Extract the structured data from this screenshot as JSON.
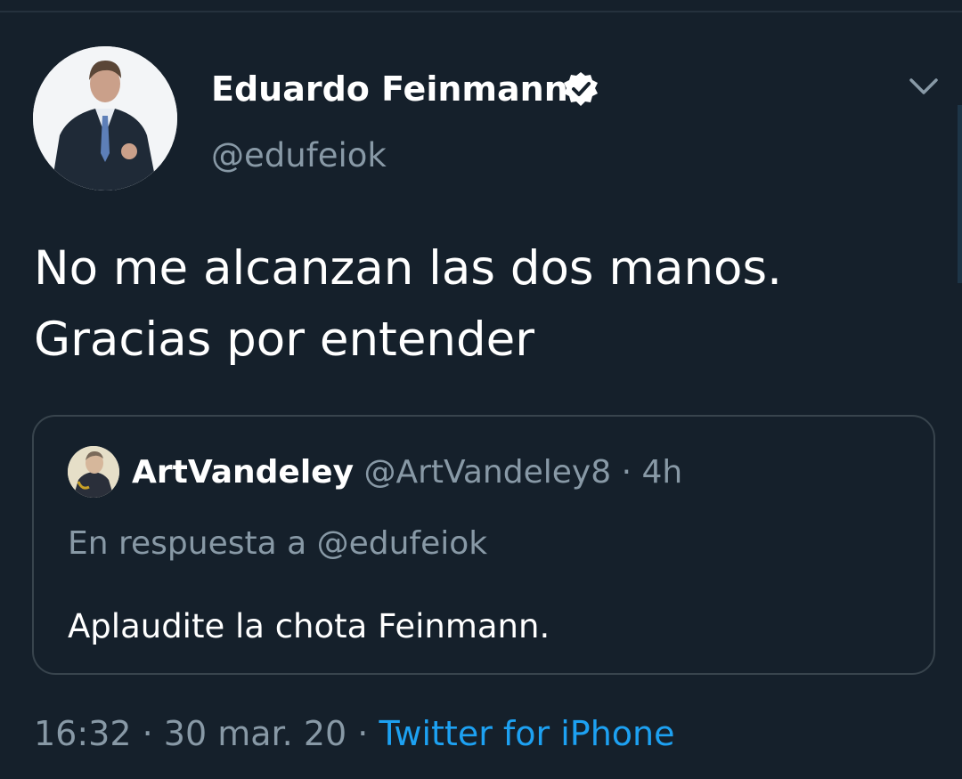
{
  "tweet": {
    "author": {
      "name": "Eduardo Feinmann",
      "handle": "@edufeiok",
      "verified": true,
      "avatar_icon": "profile-photo-man-in-suit"
    },
    "text_lines": [
      "No me alcanzan las dos manos.",
      "Gracias por entender"
    ],
    "menu_icon": "chevron-down-icon",
    "time": "16:32",
    "separator": "·",
    "date": "30 mar. 20",
    "source": "Twitter for iPhone"
  },
  "quoted_tweet": {
    "author_name": "ArtVandeley",
    "author_handle": "@ArtVandeley8",
    "separator": "·",
    "age": "4h",
    "reply_to": "En respuesta a @edufeiok",
    "text": "Aplaudite la chota Feinmann."
  },
  "colors": {
    "background": "#15202b",
    "secondary_text": "#8899a6",
    "link": "#1da1f2",
    "border": "#38444d"
  }
}
